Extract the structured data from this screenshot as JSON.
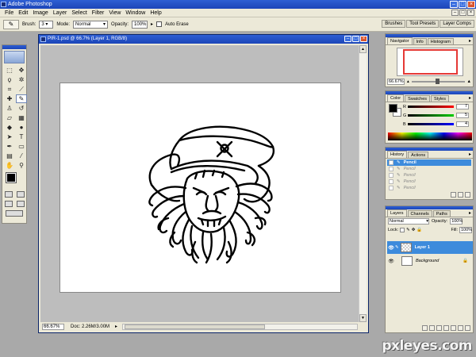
{
  "app": {
    "title": "Adobe Photoshop"
  },
  "menu": [
    "File",
    "Edit",
    "Image",
    "Layer",
    "Select",
    "Filter",
    "View",
    "Window",
    "Help"
  ],
  "options": {
    "brush_label": "Brush:",
    "brush_size": "3",
    "mode_label": "Mode:",
    "mode_value": "Normal",
    "opacity_label": "Opacity:",
    "opacity_value": "100%",
    "auto_erase": "Auto Erase",
    "palette_tabs": [
      "Brushes",
      "Tool Presets",
      "Layer Comps"
    ]
  },
  "document": {
    "title": "PIR-1.psd @ 66.7% (Layer 1, RGB/8)",
    "zoom": "66.67%",
    "doc_info": "Doc: 2.26M/3.00M"
  },
  "navigator": {
    "tabs": [
      "Navigator",
      "Info",
      "Histogram"
    ],
    "zoom": "66.67%"
  },
  "color_panel": {
    "tabs": [
      "Color",
      "Swatches",
      "Styles"
    ],
    "channels": [
      {
        "label": "R",
        "value": "7"
      },
      {
        "label": "G",
        "value": "5"
      },
      {
        "label": "B",
        "value": "4"
      }
    ]
  },
  "history": {
    "tabs": [
      "History",
      "Actions"
    ],
    "items": [
      "Pencil",
      "Pencil",
      "Pencil",
      "Pencil",
      "Pencil"
    ]
  },
  "layers": {
    "tabs": [
      "Layers",
      "Channels",
      "Paths"
    ],
    "blend_mode": "Normal",
    "opacity_label": "Opacity:",
    "opacity_value": "100%",
    "lock_label": "Lock:",
    "fill_label": "Fill:",
    "fill_value": "100%",
    "items": [
      {
        "name": "Layer 1"
      },
      {
        "name": "Background"
      }
    ]
  },
  "watermark": "pxleyes.com",
  "colors": {
    "titlebar": "#2e5fd3",
    "chrome": "#ece9d8",
    "selection": "#3d8bdc",
    "workspace": "#a9a9a9"
  }
}
